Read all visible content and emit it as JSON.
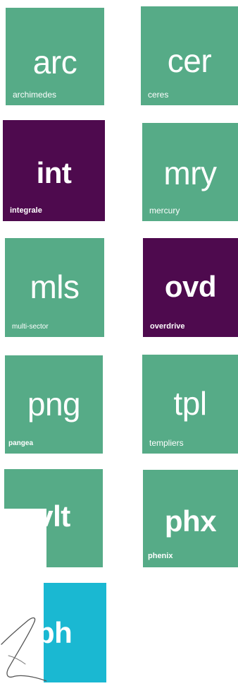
{
  "colors": {
    "green": "#56ab87",
    "purple": "#4e0a4e",
    "teal": "#1ab8d2"
  },
  "tiles": [
    {
      "abbr": "arc",
      "name": "archimedes",
      "color": "green"
    },
    {
      "abbr": "cer",
      "name": "ceres",
      "color": "green"
    },
    {
      "abbr": "int",
      "name": "integrale",
      "color": "purple"
    },
    {
      "abbr": "mry",
      "name": "mercury",
      "color": "green"
    },
    {
      "abbr": "mls",
      "name": "multi-sector",
      "color": "green"
    },
    {
      "abbr": "ovd",
      "name": "overdrive",
      "color": "purple"
    },
    {
      "abbr": "png",
      "name": "pangea",
      "color": "green"
    },
    {
      "abbr": "tpl",
      "name": "templiers",
      "color": "green"
    },
    {
      "abbr": "vlt",
      "name": "",
      "color": "green"
    },
    {
      "abbr": "phx",
      "name": "phenix",
      "color": "green"
    },
    {
      "abbr": "ph",
      "name": "",
      "color": "teal"
    }
  ],
  "signature": {
    "type": "handwritten-signature"
  }
}
